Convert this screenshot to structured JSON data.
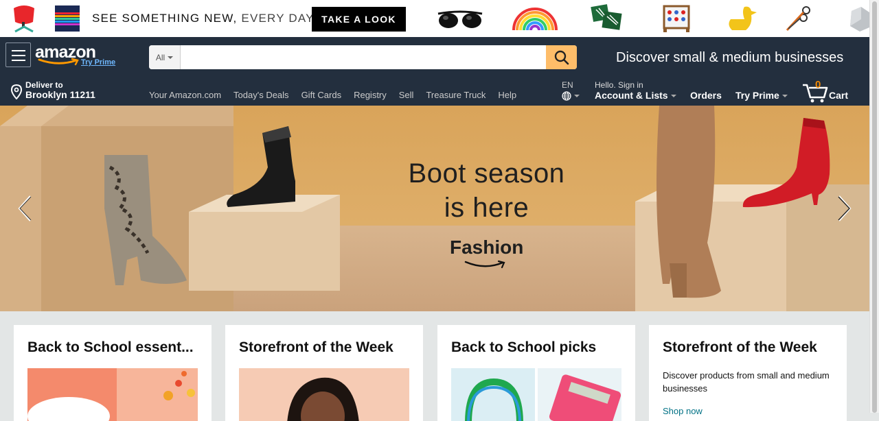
{
  "promo": {
    "text_main": "SEE SOMETHING NEW,",
    "text_light": "EVERY DAY.",
    "button_label": "TAKE A LOOK",
    "icons": [
      "red-chair-icon",
      "striped-blanket-icon",
      "sunglasses-icon",
      "rainbow-icon",
      "plant-pillows-icon",
      "connect-four-icon",
      "yellow-duck-icon",
      "scissors-icon",
      "geode-icon"
    ]
  },
  "header": {
    "logo_text": "amazon",
    "logo_prime": "Try Prime",
    "search_category": "All",
    "search_placeholder": "",
    "discover_text": "Discover small & medium businesses"
  },
  "nav": {
    "deliver_line1": "Deliver to",
    "deliver_line2": "Brooklyn 11211",
    "links": [
      "Your Amazon.com",
      "Today's Deals",
      "Gift Cards",
      "Registry",
      "Sell",
      "Treasure Truck",
      "Help"
    ],
    "lang": "EN",
    "account_line1": "Hello. Sign in",
    "account_line2": "Account & Lists",
    "orders": "Orders",
    "try_prime": "Try Prime",
    "cart_count": "0",
    "cart_label": "Cart"
  },
  "hero": {
    "headline_line1": "Boot season",
    "headline_line2": "is here",
    "brand": "Fashion"
  },
  "cards": [
    {
      "title": "Back to School essent..."
    },
    {
      "title": "Storefront of the Week"
    },
    {
      "title": "Back to School picks"
    },
    {
      "title": "Storefront of the Week",
      "description": "Discover products from small and medium businesses",
      "link": "Shop now"
    }
  ],
  "colors": {
    "nav_bg": "#232f3e",
    "search_button": "#febd69",
    "cart_count": "#f08804",
    "link": "#007185",
    "page_bg": "#e3e6e6"
  }
}
